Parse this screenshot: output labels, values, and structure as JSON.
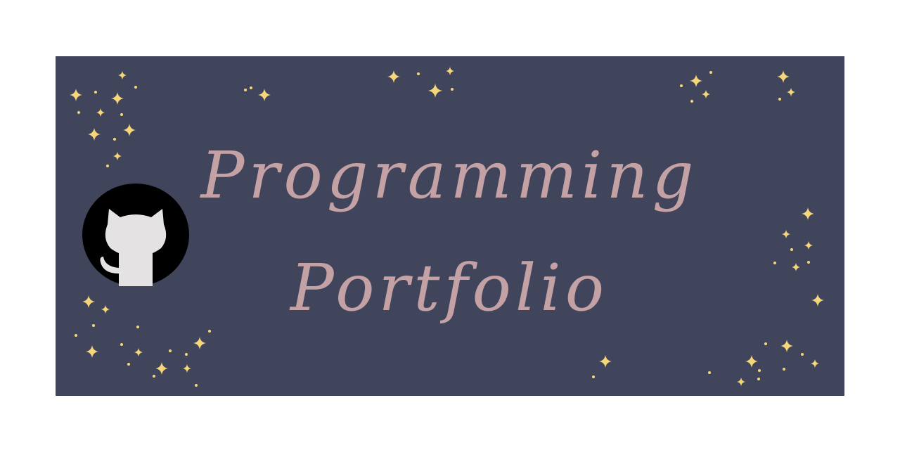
{
  "banner": {
    "title_line1": "Programming",
    "title_line2": "Portfolio",
    "logo_icon": "github-octocat-icon",
    "decoration_icon": "sparkle-star-icon",
    "colors": {
      "background": "#41455c",
      "title": "#c4a1a4",
      "star": "#f5d77a",
      "logo_circle": "#000000",
      "logo_cat": "#e4e2e2"
    }
  }
}
